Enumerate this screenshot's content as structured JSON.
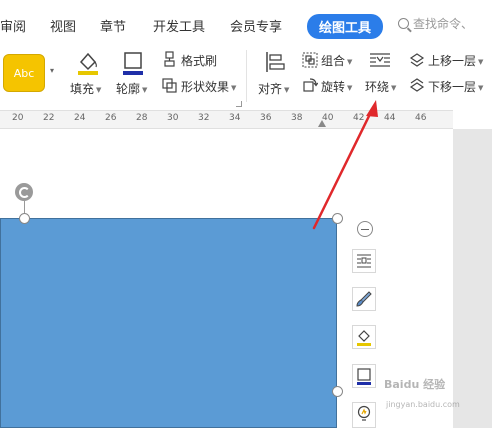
{
  "menu": {
    "items": [
      "审阅",
      "视图",
      "章节",
      "开发工具",
      "会员专享"
    ],
    "active_tab": "绘图工具",
    "search_placeholder": "查找命令、"
  },
  "ribbon": {
    "style_swatch": "Abc",
    "fill": "填充",
    "outline": "轮廓",
    "format_painter": "格式刷",
    "shape_effects": "形状效果",
    "align": "对齐",
    "group": "组合",
    "rotate": "旋转",
    "wrap": "环绕",
    "bring_forward": "上移一层",
    "send_backward": "下移一层"
  },
  "ruler": {
    "ticks": [
      "20",
      "22",
      "24",
      "26",
      "28",
      "30",
      "32",
      "34",
      "36",
      "38",
      "40",
      "42",
      "44",
      "46"
    ]
  },
  "colors": {
    "accent": "#2b7de9",
    "shape_fill": "#5b9bd5",
    "style_swatch": "#f5c400",
    "annotation_arrow": "#e0282b"
  },
  "watermark": {
    "title": "Baidu 经验",
    "url": "jingyan.baidu.com"
  }
}
